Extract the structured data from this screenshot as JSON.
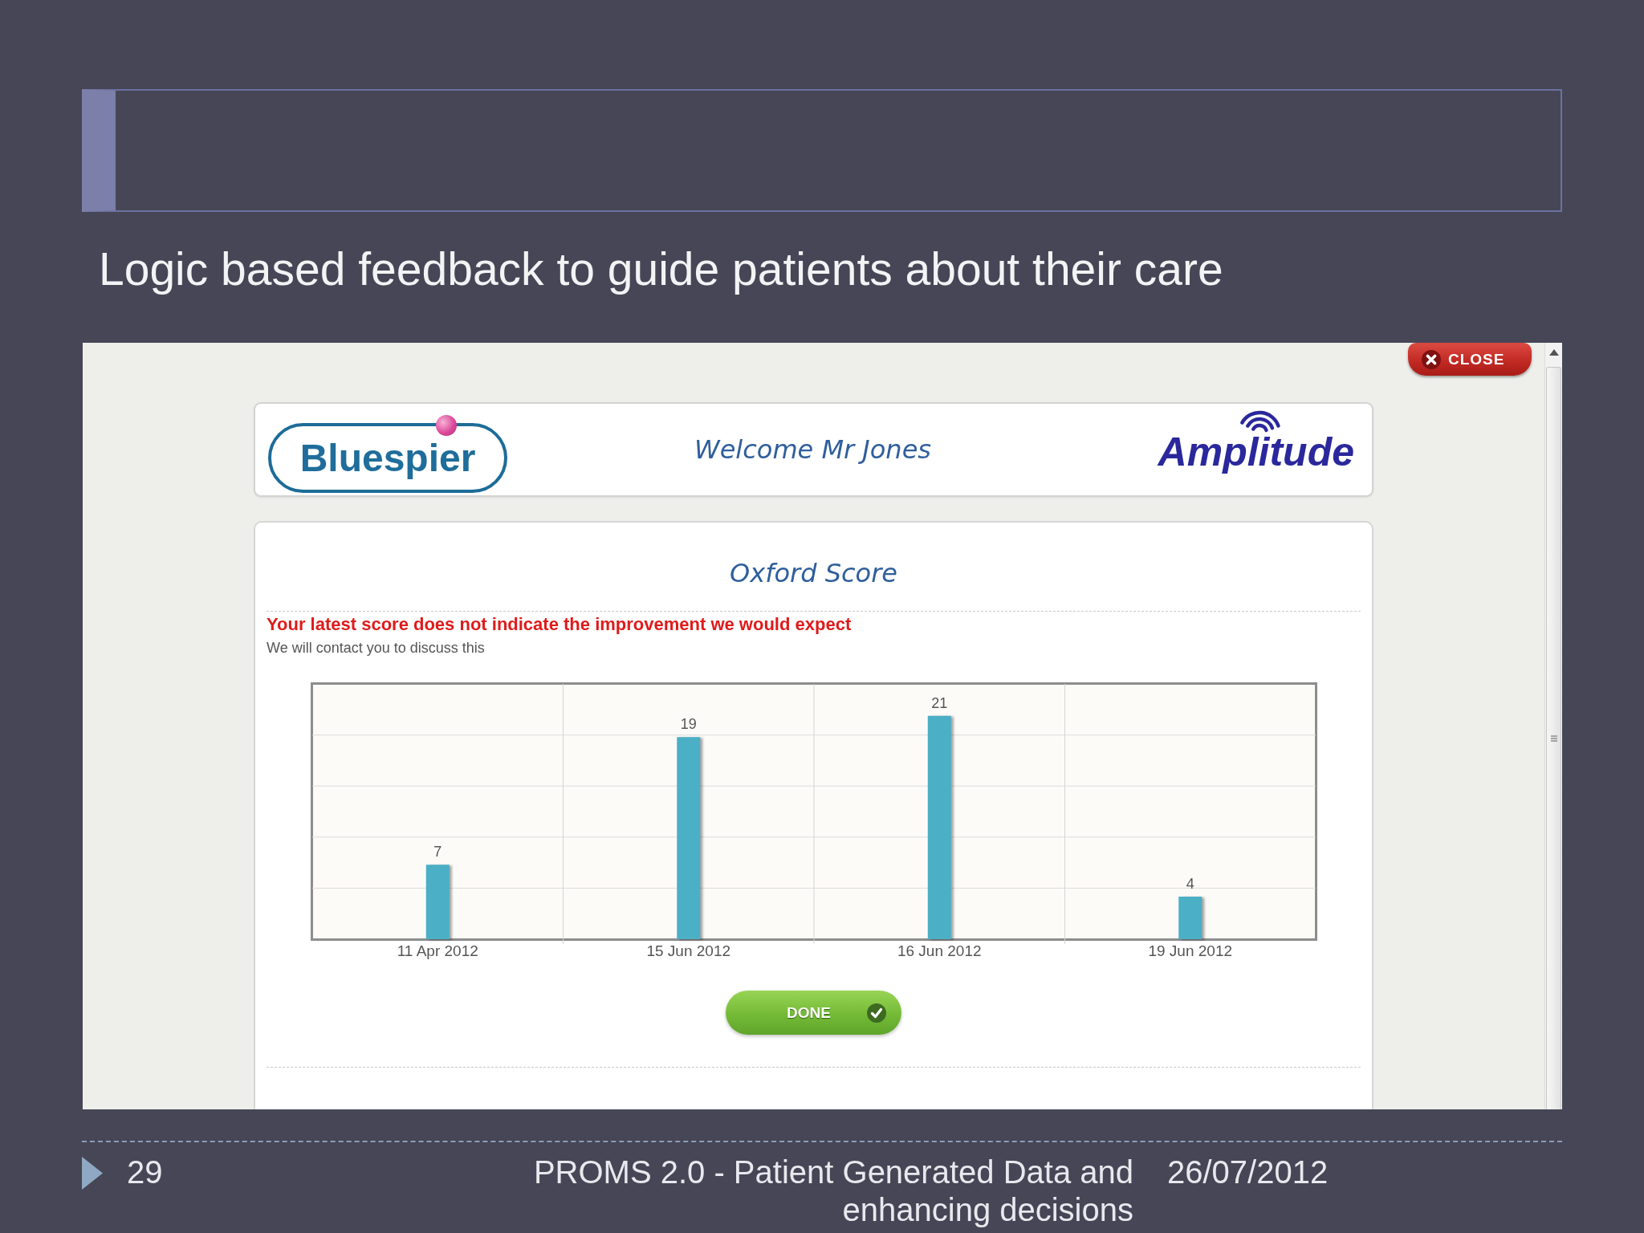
{
  "subtitle": "Logic based feedback to guide patients about their care",
  "app": {
    "close_button": {
      "label": "CLOSE"
    },
    "header": {
      "logo_left": "Bluespier",
      "welcome": "Welcome Mr Jones",
      "logo_right": "Amplitude"
    },
    "score_panel": {
      "title": "Oxford Score",
      "alert": "Your latest score does not indicate the improvement we would expect",
      "note": "We will contact you to discuss this",
      "chart_data": {
        "type": "bar",
        "categories": [
          "11 Apr 2012",
          "15 Jun 2012",
          "16 Jun 2012",
          "19 Jun 2012"
        ],
        "values": [
          7,
          19,
          21,
          4
        ],
        "color": "#4bafc6",
        "data_labels": true,
        "grid": true
      },
      "done_button": {
        "label": "DONE"
      }
    }
  },
  "footer": {
    "page_number": "29",
    "title": "PROMS 2.0 - Patient Generated Data and enhancing decisions",
    "date": "26/07/2012"
  }
}
